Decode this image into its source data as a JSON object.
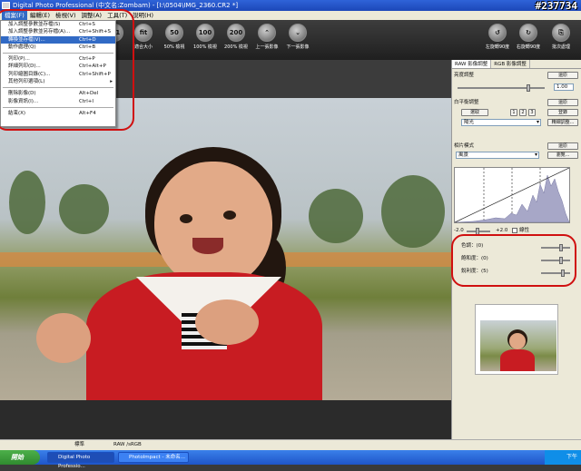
{
  "window": {
    "title": "Digital Photo Professional (中文名:Zombam) - [I:\\0504\\IMG_2360.CR2 *]"
  },
  "watermark": "#237734",
  "menu": [
    "檔案(F)",
    "編輯(E)",
    "檢視(V)",
    "調整(A)",
    "工具(T)",
    "說明(H)"
  ],
  "toolbar": {
    "buttons": [
      {
        "glyph": "1:1",
        "label": ""
      },
      {
        "glyph": "fit",
        "label": "適合大小"
      },
      {
        "glyph": "50",
        "label": "50% 檢視"
      },
      {
        "glyph": "100",
        "label": "100% 檢視"
      },
      {
        "glyph": "200",
        "label": "200% 檢視"
      },
      {
        "glyph": "⌃",
        "label": "上一張影像"
      },
      {
        "glyph": "⌄",
        "label": "下一張影像"
      }
    ],
    "right_buttons": [
      {
        "glyph": "↺",
        "label": "左旋轉90度"
      },
      {
        "glyph": "↻",
        "label": "右旋轉90度"
      },
      {
        "glyph": "⎘",
        "label": "批次處理"
      }
    ]
  },
  "file_menu": {
    "items": [
      {
        "label": "加入調整參數並存檔(S)",
        "shortcut": "Ctrl+S"
      },
      {
        "label": "加入調整參數並另存檔(A)...",
        "shortcut": "Ctrl+Shift+S"
      },
      {
        "label": "轉換並存檔(V)...",
        "shortcut": "Ctrl+D",
        "highlighted": true
      },
      {
        "label": "動作處理(Q)",
        "shortcut": "Ctrl+B"
      },
      {
        "sep": true
      },
      {
        "label": "列印(P)...",
        "shortcut": "Ctrl+P"
      },
      {
        "label": "詳細列印(D)...",
        "shortcut": "Ctrl+Alt+P"
      },
      {
        "label": "列印縮圖目錄(C)...",
        "shortcut": "Ctrl+Shift+P"
      },
      {
        "label": "其他列印選項(L)",
        "shortcut": "",
        "submenu": true
      },
      {
        "sep": true
      },
      {
        "label": "刪除影像(D)",
        "shortcut": "Alt+Del"
      },
      {
        "label": "影像資訊(I)...",
        "shortcut": "Ctrl+I"
      },
      {
        "sep": true
      },
      {
        "label": "結束(X)",
        "shortcut": "Alt+F4"
      }
    ]
  },
  "panel": {
    "tabs": [
      "RAW 影像調整",
      "RGB 影像調整"
    ],
    "brightness": {
      "title": "亮度調整",
      "reset": "還原",
      "value": "1.00"
    },
    "white_balance": {
      "title": "白平衡調整",
      "reset": "還原",
      "picker": "選取",
      "pages": [
        "1",
        "2",
        "3"
      ],
      "register": "登錄",
      "preset": "陽光",
      "fine_tune": "精細調整..."
    },
    "picture_style": {
      "title": "相片模式",
      "reset": "還原",
      "style": "風景",
      "browse": "瀏覽..."
    },
    "histogram": {
      "min": "-2.0",
      "max": "+2.0",
      "linear": "線性"
    },
    "tone": [
      {
        "label": "色調：",
        "value": "0"
      },
      {
        "label": "飽和度：",
        "value": "0"
      },
      {
        "label": "銳利度：",
        "value": "5"
      }
    ]
  },
  "status": {
    "cell1": "標準",
    "cell2": "RAW /sRGB"
  },
  "taskbar": {
    "start": "開始",
    "tasks": [
      "Digital Photo Professio...",
      "PhotoImpact - 未命名..."
    ],
    "clock": "下午"
  }
}
